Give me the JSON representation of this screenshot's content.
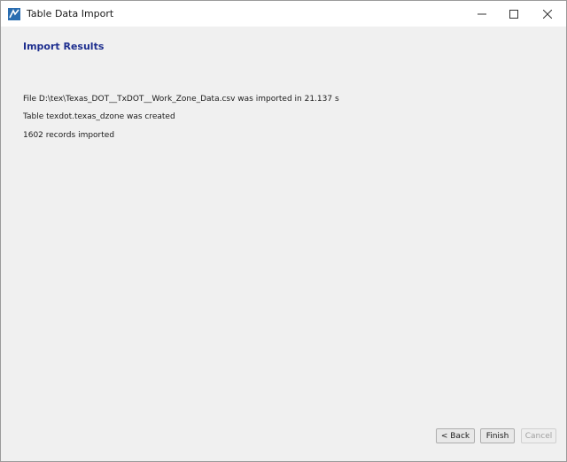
{
  "window": {
    "title": "Table Data Import",
    "icon": "app-logo-icon",
    "controls": {
      "minimize_icon": "minimize-icon",
      "maximize_icon": "maximize-icon",
      "close_icon": "close-icon"
    }
  },
  "main": {
    "heading": "Import Results",
    "messages": [
      "File D:\\tex\\Texas_DOT__TxDOT__Work_Zone_Data.csv was imported in 21.137 s",
      "Table texdot.texas_dzone was created",
      "1602 records imported"
    ]
  },
  "footer": {
    "back_label": "< Back",
    "finish_label": "Finish",
    "cancel_label": "Cancel"
  },
  "colors": {
    "heading": "#1e2f8f",
    "background": "#f0f0f0",
    "titlebar": "#ffffff"
  }
}
